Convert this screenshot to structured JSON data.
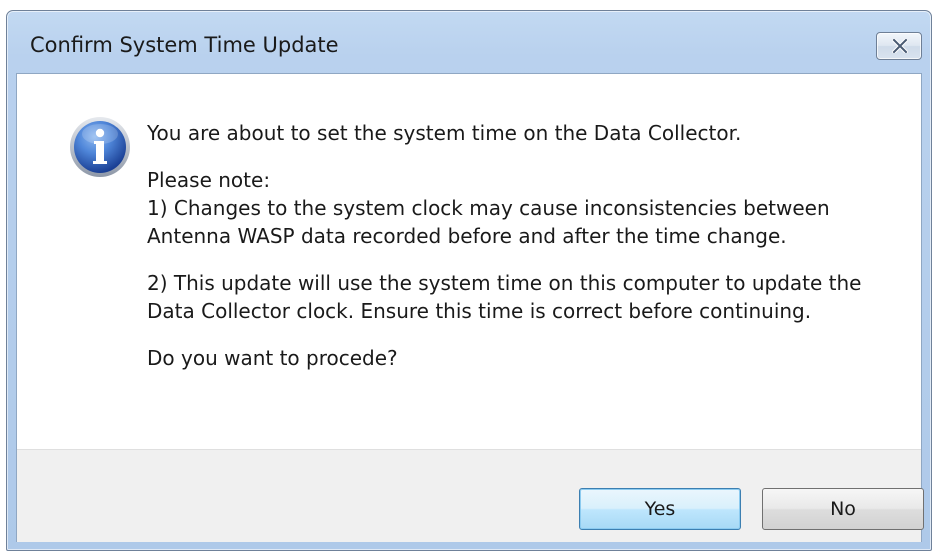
{
  "window": {
    "title": "Confirm System Time Update",
    "close_icon": "close-icon"
  },
  "icon": {
    "name": "info-icon",
    "glyph": "i",
    "colors": {
      "ring": "#9aa4b3",
      "fill_light": "#5f95e0",
      "fill_dark": "#1f4ea8"
    }
  },
  "message": {
    "line1": "You are about to set the system time on the Data Collector.",
    "note_header": "Please note:",
    "note1_line1": "1) Changes to the system clock may cause inconsistencies between",
    "note1_line2": "Antenna WASP data recorded before and after the time change.",
    "note2_line1": "2) This update will use the system time on this computer to update the",
    "note2_line2": "Data Collector clock. Ensure this time is correct before continuing.",
    "question": "Do you want to procede?"
  },
  "buttons": {
    "yes_label": "Yes",
    "no_label": "No"
  },
  "colors": {
    "titlebar": "#b9d1ee",
    "footer": "#f0f0f0",
    "default_button_border": "#3c7fb1"
  }
}
